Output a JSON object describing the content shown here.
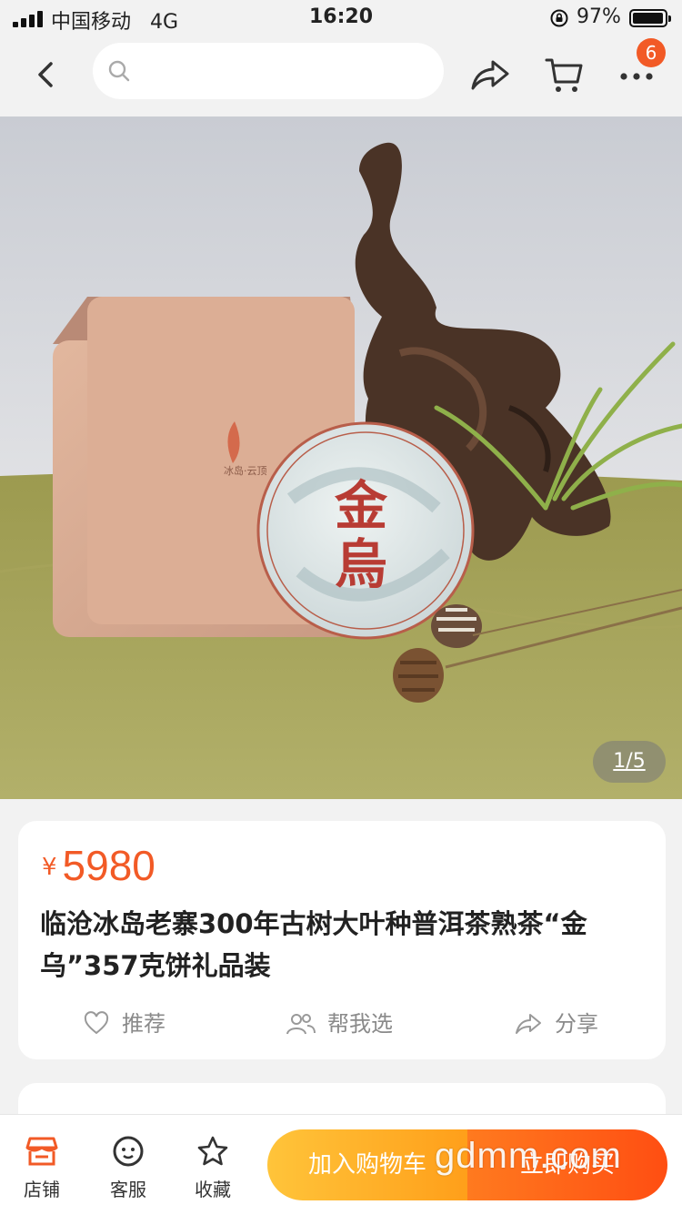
{
  "status_bar": {
    "carrier": "中国移动",
    "network": "4G",
    "time": "16:20",
    "battery_percent": "97%",
    "battery_level": 0.97
  },
  "nav": {
    "search_placeholder": "",
    "cart_badge": "6",
    "icons": [
      "back-icon",
      "search-icon",
      "share-icon",
      "cart-icon",
      "more-icon"
    ]
  },
  "hero": {
    "image_counter": "1/5",
    "tea_cake_label": "金烏"
  },
  "product": {
    "currency": "¥",
    "price": "5980",
    "title": "临沧冰岛老寨300年古树大叶种普洱茶熟茶“金乌”357克饼礼品装",
    "actions": {
      "recommend": "推荐",
      "help_choose": "帮我选",
      "share": "分享"
    }
  },
  "bottom_bar": {
    "shop": "店铺",
    "service": "客服",
    "favorite": "收藏",
    "add_to_cart": "加入购物车",
    "buy_now": "立即购买"
  },
  "watermark": "gdmm.com",
  "colors": {
    "accent": "#f25a26",
    "cart_button": "#ffb22a",
    "buy_button": "#ff5a16"
  }
}
